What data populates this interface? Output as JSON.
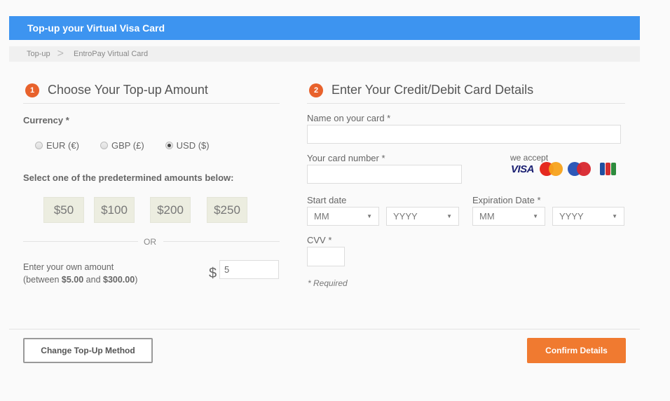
{
  "header": {
    "title": "Top-up your Virtual Visa Card"
  },
  "breadcrumb": {
    "items": [
      "Top-up",
      "EntroPay Virtual Card"
    ],
    "separator": ">"
  },
  "section1": {
    "step": "1",
    "title": "Choose Your Top-up Amount",
    "currency_label": "Currency *",
    "currencies": [
      {
        "label": "EUR (€)",
        "checked": false
      },
      {
        "label": "GBP (£)",
        "checked": false
      },
      {
        "label": "USD ($)",
        "checked": true
      }
    ],
    "predetermined_label": "Select one of the predetermined amounts below:",
    "amounts": [
      "$50",
      "$100",
      "$200",
      "$250"
    ],
    "or_label": "OR",
    "own_amount_label": "Enter your own amount",
    "own_amount_range_prefix": "(between ",
    "own_amount_min": "$5.00",
    "own_amount_and": " and ",
    "own_amount_max": "$300.00",
    "own_amount_suffix": ")",
    "currency_symbol": "$",
    "own_amount_value": "5"
  },
  "section2": {
    "step": "2",
    "title": "Enter Your Credit/Debit Card Details",
    "name_label": "Name on your card *",
    "name_value": "",
    "card_number_label": "Your card number *",
    "card_number_value": "",
    "we_accept_label": "we accept",
    "card_brands": [
      "visa-logo",
      "mastercard-logo",
      "maestro-logo",
      "jcb-logo"
    ],
    "visa_text": "VISA",
    "start_date_label": "Start date",
    "start_month": "MM",
    "start_year": "YYYY",
    "expiration_label": "Expiration Date *",
    "exp_month": "MM",
    "exp_year": "YYYY",
    "cvv_label": "CVV *",
    "cvv_value": "",
    "required_note": "* Required"
  },
  "footer": {
    "change_method_label": "Change Top-Up Method",
    "confirm_label": "Confirm Details"
  },
  "colors": {
    "header_blue": "#3d94f0",
    "accent_orange": "#f07a30",
    "step_badge": "#e8622c"
  }
}
